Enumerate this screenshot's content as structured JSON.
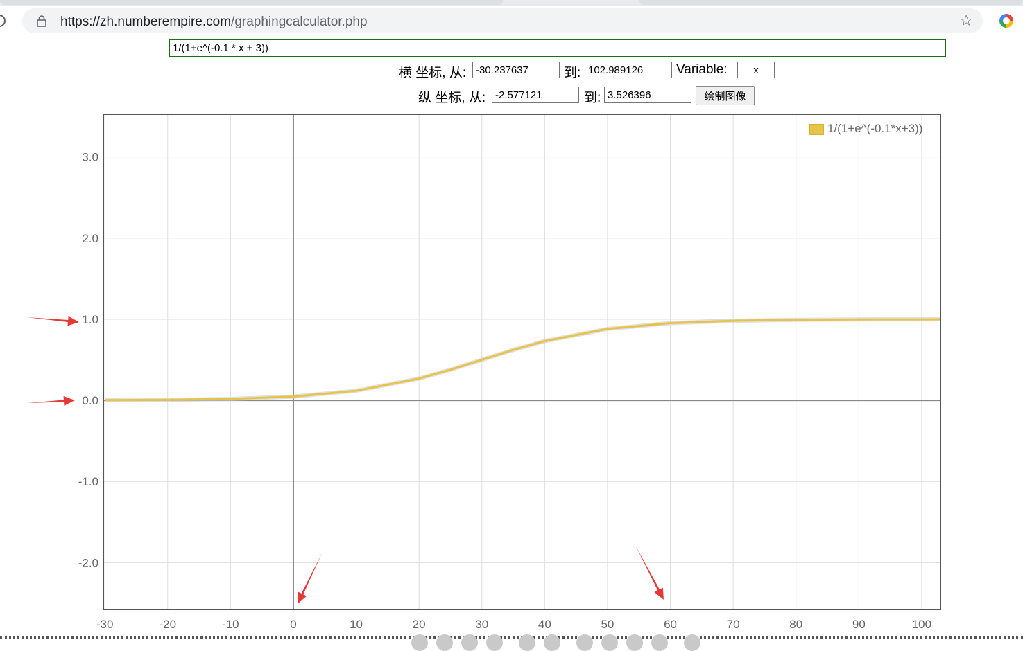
{
  "browser": {
    "url_domain": "https://zh.numberempire.com",
    "url_path": "/graphingcalculator.php",
    "star_icon": "star-outline-icon",
    "lock_icon": "lock-icon"
  },
  "form": {
    "function_value": "1/(1+e^(-0.1 * x + 3))",
    "x_from_label": "横 坐标, 从:",
    "x_from_value": "-30.237637",
    "x_to_label": "到:",
    "x_to_value": "102.989126",
    "variable_label": "Variable:",
    "variable_value": "x",
    "y_from_label": "纵 坐标, 从:",
    "y_from_value": "-2.577121",
    "y_to_label": "到:",
    "y_to_value": "3.526396",
    "plot_button": "绘制图像"
  },
  "chart_data": {
    "type": "line",
    "title": "",
    "xlabel": "",
    "ylabel": "",
    "xlim": [
      -30.237637,
      102.989126
    ],
    "ylim": [
      -2.577121,
      3.526396
    ],
    "x_ticks": [
      -30,
      -20,
      -10,
      0,
      10,
      20,
      30,
      40,
      50,
      60,
      70,
      80,
      90,
      100
    ],
    "x_tick_labels": [
      "-30",
      "-20",
      "-10",
      "0",
      "10",
      "20",
      "30",
      "40",
      "50",
      "60",
      "70",
      "80",
      "90",
      "100"
    ],
    "y_ticks": [
      3,
      2,
      1,
      0,
      -1,
      -2
    ],
    "y_tick_labels": [
      "3.0",
      "2.0",
      "1.0",
      "0.0",
      "-1.0",
      "-2.0"
    ],
    "grid": true,
    "legend_position": "top-right",
    "series": [
      {
        "name": "1/(1+e^(-0.1*x+3))",
        "color": "#e8c34a",
        "x": [
          -30,
          -20,
          -10,
          0,
          10,
          20,
          25,
          30,
          35,
          40,
          50,
          60,
          70,
          80,
          90,
          100,
          103
        ],
        "y": [
          0.0025,
          0.0067,
          0.018,
          0.047,
          0.119,
          0.269,
          0.378,
          0.5,
          0.622,
          0.731,
          0.881,
          0.953,
          0.982,
          0.993,
          0.998,
          0.999,
          0.9995
        ]
      }
    ],
    "annotations": [
      {
        "type": "arrow",
        "color": "#e53935",
        "points_to": "y-tick 1.0"
      },
      {
        "type": "arrow",
        "color": "#e53935",
        "points_to": "y-tick 0.0"
      },
      {
        "type": "arrow",
        "color": "#e53935",
        "points_to": "x-tick 0"
      },
      {
        "type": "arrow",
        "color": "#e53935",
        "points_to": "x-tick 60"
      }
    ]
  },
  "colors": {
    "function_border": "#1a6e1a",
    "curve": "#e8c34a",
    "axis": "#888888",
    "grid": "#dddddd",
    "frame": "#555555",
    "arrow": "#e53935"
  }
}
